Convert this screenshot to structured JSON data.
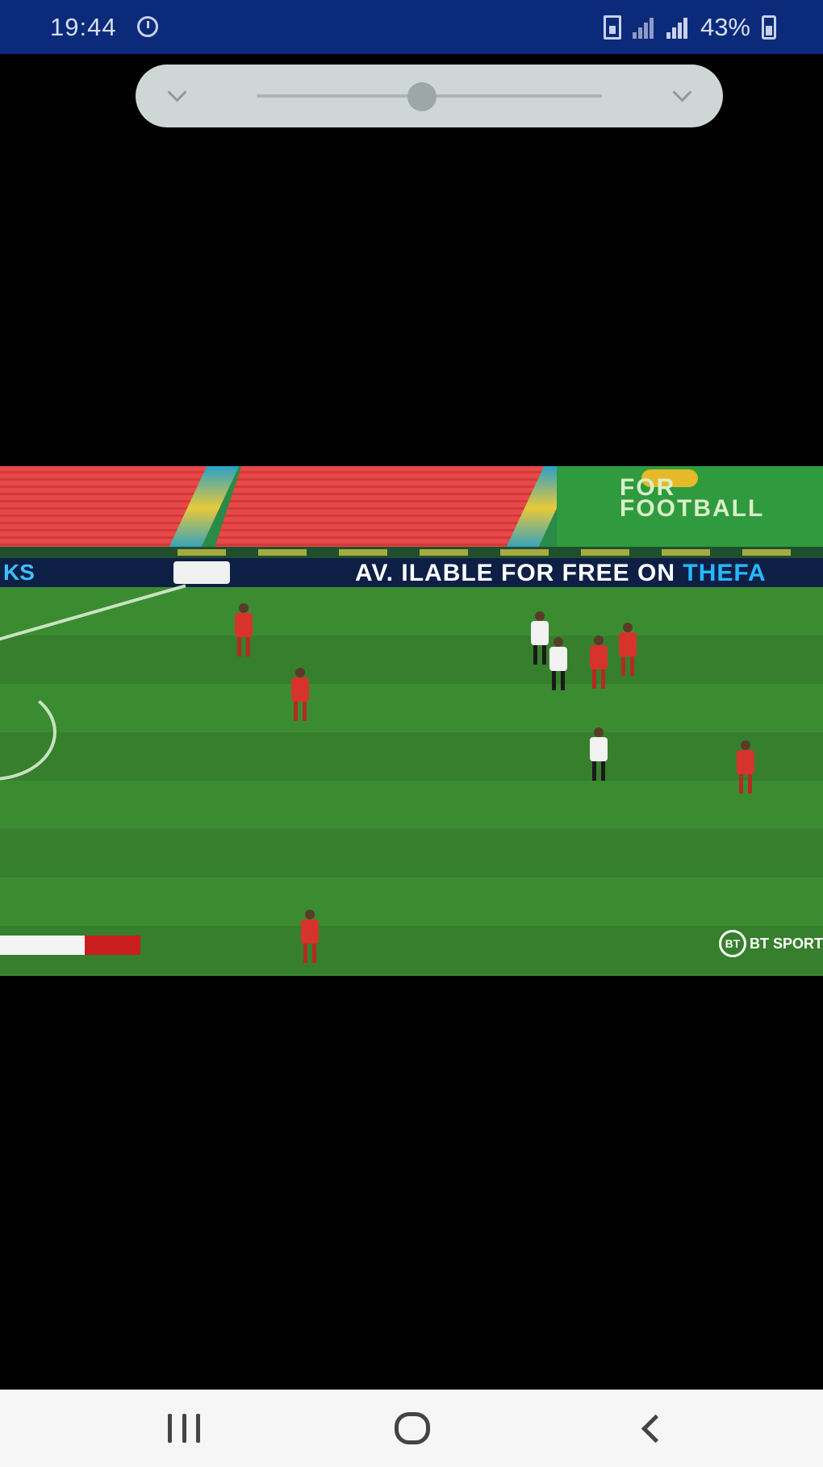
{
  "status_bar": {
    "time": "19:44",
    "battery_percent": "43%",
    "icons": [
      "clock-icon",
      "sim-card-icon",
      "signal-icon",
      "signal-icon",
      "battery-icon"
    ]
  },
  "slider": {
    "left_icon": "chevron-down-icon",
    "right_icon": "chevron-down-icon",
    "value_fraction": 0.48
  },
  "video": {
    "hoarding_left": "KS",
    "hoarding_text": "AV. ILABLE FOR FREE ON ",
    "hoarding_accent": "THEFA",
    "stand_text": "FOR FOOTBALL",
    "score_home": "",
    "score_away": "",
    "broadcaster": "BT SPORT"
  },
  "nav_bar": {
    "recent_icon": "recent-apps-icon",
    "home_icon": "home-icon",
    "back_icon": "back-icon"
  },
  "colors": {
    "status_bar_bg": "#0b2a7a",
    "pill_bg": "#cfd6d6",
    "nav_bar_bg": "#f6f6f6",
    "pitch_green": "#3b8c31"
  }
}
